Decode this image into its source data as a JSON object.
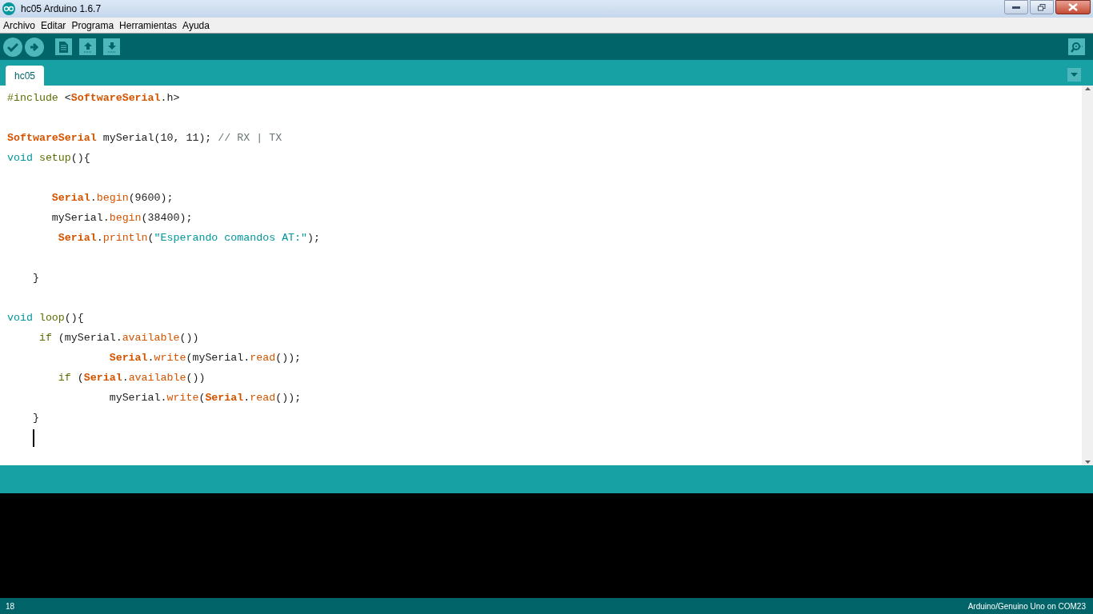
{
  "window": {
    "title": "hc05 Arduino 1.6.7"
  },
  "menu": [
    "Archivo",
    "Editar",
    "Programa",
    "Herramientas",
    "Ayuda"
  ],
  "tabs": [
    {
      "label": "hc05",
      "selected": true
    }
  ],
  "editor": {
    "lines": [
      {
        "kind": "code",
        "tokens": [
          {
            "kind": "directive",
            "text": "#include"
          },
          {
            "kind": "plain",
            "text": " <"
          },
          {
            "kind": "class",
            "text": "SoftwareSerial"
          },
          {
            "kind": "plain",
            "text": ".h>"
          }
        ]
      },
      {
        "kind": "blank"
      },
      {
        "kind": "code",
        "tokens": [
          {
            "kind": "class",
            "text": "SoftwareSerial"
          },
          {
            "kind": "plain",
            "text": " mySerial(10, 11); "
          },
          {
            "kind": "comment",
            "text": "// RX | TX"
          }
        ]
      },
      {
        "kind": "code",
        "tokens": [
          {
            "kind": "keyword",
            "text": "void"
          },
          {
            "kind": "directive",
            "text": " setup"
          },
          {
            "kind": "plain",
            "text": "(){"
          }
        ]
      },
      {
        "kind": "blank"
      },
      {
        "kind": "code",
        "tokens": [
          {
            "kind": "class",
            "text": "       Serial"
          },
          {
            "kind": "plain",
            "text": "."
          },
          {
            "kind": "function",
            "text": "begin"
          },
          {
            "kind": "plain",
            "text": "(9600);"
          }
        ]
      },
      {
        "kind": "code",
        "tokens": [
          {
            "kind": "plain",
            "text": "       mySerial."
          },
          {
            "kind": "function",
            "text": "begin"
          },
          {
            "kind": "plain",
            "text": "(38400);"
          }
        ]
      },
      {
        "kind": "code",
        "tokens": [
          {
            "kind": "class",
            "text": "        Serial"
          },
          {
            "kind": "plain",
            "text": "."
          },
          {
            "kind": "function",
            "text": "println"
          },
          {
            "kind": "plain",
            "text": "("
          },
          {
            "kind": "string",
            "text": "\"Esperando comandos AT:\""
          },
          {
            "kind": "plain",
            "text": ");"
          }
        ]
      },
      {
        "kind": "blank"
      },
      {
        "kind": "code",
        "tokens": [
          {
            "kind": "plain",
            "text": "    }"
          }
        ]
      },
      {
        "kind": "blank"
      },
      {
        "kind": "code",
        "tokens": [
          {
            "kind": "keyword",
            "text": "void"
          },
          {
            "kind": "directive",
            "text": " loop"
          },
          {
            "kind": "plain",
            "text": "(){"
          }
        ]
      },
      {
        "kind": "code",
        "tokens": [
          {
            "kind": "directive",
            "text": "     if"
          },
          {
            "kind": "plain",
            "text": " (mySerial."
          },
          {
            "kind": "function",
            "text": "available"
          },
          {
            "kind": "plain",
            "text": "())"
          }
        ]
      },
      {
        "kind": "code",
        "tokens": [
          {
            "kind": "class",
            "text": "                Serial"
          },
          {
            "kind": "plain",
            "text": "."
          },
          {
            "kind": "function",
            "text": "write"
          },
          {
            "kind": "plain",
            "text": "(mySerial."
          },
          {
            "kind": "function",
            "text": "read"
          },
          {
            "kind": "plain",
            "text": "());"
          }
        ]
      },
      {
        "kind": "code",
        "tokens": [
          {
            "kind": "directive",
            "text": "        if"
          },
          {
            "kind": "plain",
            "text": " ("
          },
          {
            "kind": "class",
            "text": "Serial"
          },
          {
            "kind": "plain",
            "text": "."
          },
          {
            "kind": "function",
            "text": "available"
          },
          {
            "kind": "plain",
            "text": "())"
          }
        ]
      },
      {
        "kind": "code",
        "tokens": [
          {
            "kind": "plain",
            "text": "                mySerial."
          },
          {
            "kind": "function",
            "text": "write"
          },
          {
            "kind": "plain",
            "text": "("
          },
          {
            "kind": "class",
            "text": "Serial"
          },
          {
            "kind": "plain",
            "text": "."
          },
          {
            "kind": "function",
            "text": "read"
          },
          {
            "kind": "plain",
            "text": "());"
          }
        ]
      },
      {
        "kind": "code",
        "tokens": [
          {
            "kind": "plain",
            "text": "    }"
          }
        ]
      },
      {
        "kind": "cursor"
      }
    ]
  },
  "status_bar": {
    "line": "18",
    "board": "Arduino/Genuino Uno on COM23"
  }
}
